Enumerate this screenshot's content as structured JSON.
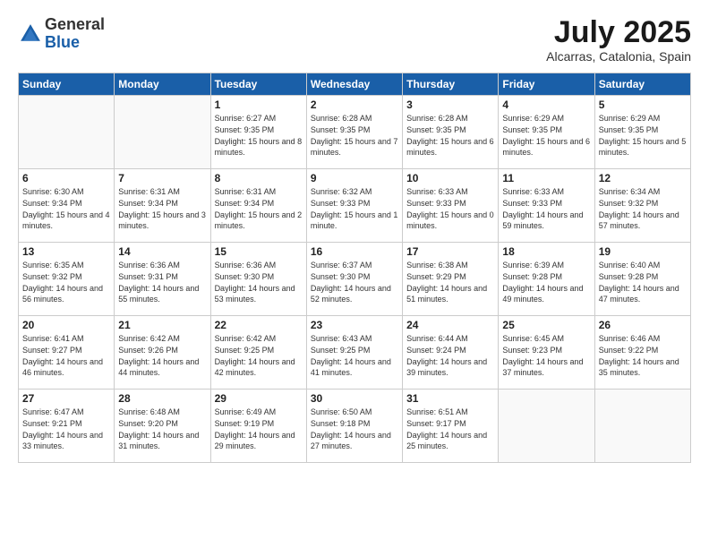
{
  "header": {
    "logo_general": "General",
    "logo_blue": "Blue",
    "month_title": "July 2025",
    "location": "Alcarras, Catalonia, Spain"
  },
  "days_of_week": [
    "Sunday",
    "Monday",
    "Tuesday",
    "Wednesday",
    "Thursday",
    "Friday",
    "Saturday"
  ],
  "weeks": [
    [
      {
        "day": "",
        "info": ""
      },
      {
        "day": "",
        "info": ""
      },
      {
        "day": "1",
        "info": "Sunrise: 6:27 AM\nSunset: 9:35 PM\nDaylight: 15 hours\nand 8 minutes."
      },
      {
        "day": "2",
        "info": "Sunrise: 6:28 AM\nSunset: 9:35 PM\nDaylight: 15 hours\nand 7 minutes."
      },
      {
        "day": "3",
        "info": "Sunrise: 6:28 AM\nSunset: 9:35 PM\nDaylight: 15 hours\nand 6 minutes."
      },
      {
        "day": "4",
        "info": "Sunrise: 6:29 AM\nSunset: 9:35 PM\nDaylight: 15 hours\nand 6 minutes."
      },
      {
        "day": "5",
        "info": "Sunrise: 6:29 AM\nSunset: 9:35 PM\nDaylight: 15 hours\nand 5 minutes."
      }
    ],
    [
      {
        "day": "6",
        "info": "Sunrise: 6:30 AM\nSunset: 9:34 PM\nDaylight: 15 hours\nand 4 minutes."
      },
      {
        "day": "7",
        "info": "Sunrise: 6:31 AM\nSunset: 9:34 PM\nDaylight: 15 hours\nand 3 minutes."
      },
      {
        "day": "8",
        "info": "Sunrise: 6:31 AM\nSunset: 9:34 PM\nDaylight: 15 hours\nand 2 minutes."
      },
      {
        "day": "9",
        "info": "Sunrise: 6:32 AM\nSunset: 9:33 PM\nDaylight: 15 hours\nand 1 minute."
      },
      {
        "day": "10",
        "info": "Sunrise: 6:33 AM\nSunset: 9:33 PM\nDaylight: 15 hours\nand 0 minutes."
      },
      {
        "day": "11",
        "info": "Sunrise: 6:33 AM\nSunset: 9:33 PM\nDaylight: 14 hours\nand 59 minutes."
      },
      {
        "day": "12",
        "info": "Sunrise: 6:34 AM\nSunset: 9:32 PM\nDaylight: 14 hours\nand 57 minutes."
      }
    ],
    [
      {
        "day": "13",
        "info": "Sunrise: 6:35 AM\nSunset: 9:32 PM\nDaylight: 14 hours\nand 56 minutes."
      },
      {
        "day": "14",
        "info": "Sunrise: 6:36 AM\nSunset: 9:31 PM\nDaylight: 14 hours\nand 55 minutes."
      },
      {
        "day": "15",
        "info": "Sunrise: 6:36 AM\nSunset: 9:30 PM\nDaylight: 14 hours\nand 53 minutes."
      },
      {
        "day": "16",
        "info": "Sunrise: 6:37 AM\nSunset: 9:30 PM\nDaylight: 14 hours\nand 52 minutes."
      },
      {
        "day": "17",
        "info": "Sunrise: 6:38 AM\nSunset: 9:29 PM\nDaylight: 14 hours\nand 51 minutes."
      },
      {
        "day": "18",
        "info": "Sunrise: 6:39 AM\nSunset: 9:28 PM\nDaylight: 14 hours\nand 49 minutes."
      },
      {
        "day": "19",
        "info": "Sunrise: 6:40 AM\nSunset: 9:28 PM\nDaylight: 14 hours\nand 47 minutes."
      }
    ],
    [
      {
        "day": "20",
        "info": "Sunrise: 6:41 AM\nSunset: 9:27 PM\nDaylight: 14 hours\nand 46 minutes."
      },
      {
        "day": "21",
        "info": "Sunrise: 6:42 AM\nSunset: 9:26 PM\nDaylight: 14 hours\nand 44 minutes."
      },
      {
        "day": "22",
        "info": "Sunrise: 6:42 AM\nSunset: 9:25 PM\nDaylight: 14 hours\nand 42 minutes."
      },
      {
        "day": "23",
        "info": "Sunrise: 6:43 AM\nSunset: 9:25 PM\nDaylight: 14 hours\nand 41 minutes."
      },
      {
        "day": "24",
        "info": "Sunrise: 6:44 AM\nSunset: 9:24 PM\nDaylight: 14 hours\nand 39 minutes."
      },
      {
        "day": "25",
        "info": "Sunrise: 6:45 AM\nSunset: 9:23 PM\nDaylight: 14 hours\nand 37 minutes."
      },
      {
        "day": "26",
        "info": "Sunrise: 6:46 AM\nSunset: 9:22 PM\nDaylight: 14 hours\nand 35 minutes."
      }
    ],
    [
      {
        "day": "27",
        "info": "Sunrise: 6:47 AM\nSunset: 9:21 PM\nDaylight: 14 hours\nand 33 minutes."
      },
      {
        "day": "28",
        "info": "Sunrise: 6:48 AM\nSunset: 9:20 PM\nDaylight: 14 hours\nand 31 minutes."
      },
      {
        "day": "29",
        "info": "Sunrise: 6:49 AM\nSunset: 9:19 PM\nDaylight: 14 hours\nand 29 minutes."
      },
      {
        "day": "30",
        "info": "Sunrise: 6:50 AM\nSunset: 9:18 PM\nDaylight: 14 hours\nand 27 minutes."
      },
      {
        "day": "31",
        "info": "Sunrise: 6:51 AM\nSunset: 9:17 PM\nDaylight: 14 hours\nand 25 minutes."
      },
      {
        "day": "",
        "info": ""
      },
      {
        "day": "",
        "info": ""
      }
    ]
  ]
}
